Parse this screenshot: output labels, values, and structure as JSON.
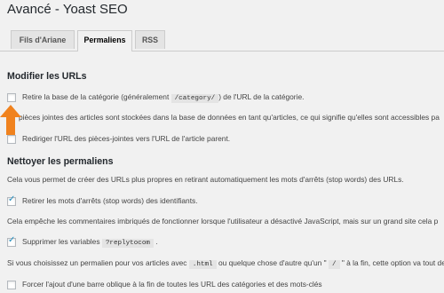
{
  "page": {
    "title": "Avancé - Yoast SEO"
  },
  "tabs": [
    {
      "label": "Fils d'Ariane",
      "active": false
    },
    {
      "label": "Permaliens",
      "active": true
    },
    {
      "label": "RSS",
      "active": false
    }
  ],
  "section1": {
    "title": "Modifier les URLs",
    "option1": {
      "before": "Retire la base de la catégorie (généralement ",
      "code": "/category/",
      "after": ") de l'URL de la catégorie.",
      "checked": false
    },
    "option2": {
      "text": "pièces jointes des articles sont stockées dans la base de données en tant qu'articles, ce qui signifie qu'elles sont accessibles pa",
      "checked": false
    },
    "option3": {
      "text": "Rediriger l'URL des pièces-jointes vers l'URL de l'article parent.",
      "checked": false
    }
  },
  "section2": {
    "title": "Nettoyer les permaliens",
    "intro": "Cela vous permet de créer des URLs plus propres en retirant automatiquement les mots d'arrêts (stop words) des URLs.",
    "option1": {
      "text": "Retirer les mots d'arrêts (stop words) des identifiants.",
      "checked": true
    },
    "para2": "Cela empêche les commentaires imbriqués de fonctionner lorsque l'utilisateur a désactivé JavaScript, mais sur un grand site cela p",
    "option2": {
      "before": "Supprimer les variables ",
      "code": "?replytocom",
      "after": " .",
      "checked": true
    },
    "para3": {
      "before": "Si vous choisissez un permalien pour vos articles avec ",
      "code1": ".html",
      "middle": " ou quelque chose d'autre qu'un \" ",
      "code2": "/",
      "after": " \" à la fin, cette option va tout de"
    },
    "option3": {
      "text": "Forcer l'ajout d'une barre oblique à la fin de toutes les URL des catégories et des mots-clés",
      "checked": false
    }
  },
  "colors": {
    "arrow": "#f0821e",
    "check": "#1e8cbe"
  }
}
